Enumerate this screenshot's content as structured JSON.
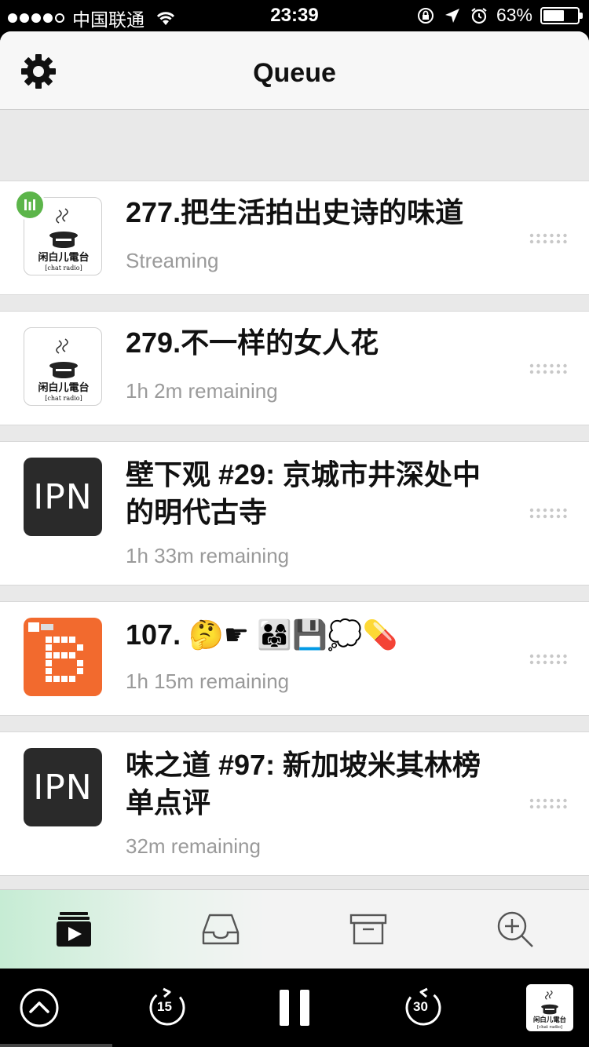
{
  "status_bar": {
    "carrier": "中国联通",
    "time": "23:39",
    "battery_percent": "63%",
    "battery_level": 0.63
  },
  "nav": {
    "title": "Queue",
    "settings_icon": "gear-icon"
  },
  "episodes": [
    {
      "title": "277.把生活拍出史诗的味道",
      "subtitle": "Streaming",
      "artwork": "chat-radio",
      "artwork_text": "闲白儿電台 [chat radio]",
      "now_playing": true
    },
    {
      "title": "279.不一样的女人花",
      "subtitle": "1h 2m remaining",
      "artwork": "chat-radio",
      "artwork_text": "闲白儿電台 [chat radio]"
    },
    {
      "title": "壁下观 #29: 京城市井深处中的明代古寺",
      "subtitle": "1h 33m remaining",
      "artwork": "ipn",
      "artwork_text": "IPN"
    },
    {
      "title": "107. 🤔☛ 👨‍👩‍👧💾💭💊",
      "subtitle": "1h 15m remaining",
      "artwork": "banjan",
      "artwork_text": "B"
    },
    {
      "title": "味之道 #97: 新加坡米其林榜单点评",
      "subtitle": "32m remaining",
      "artwork": "ipn",
      "artwork_text": "IPN"
    }
  ],
  "tabs": [
    {
      "name": "queue",
      "icon": "queue-play-icon",
      "active": true
    },
    {
      "name": "inbox",
      "icon": "inbox-icon"
    },
    {
      "name": "archive",
      "icon": "archive-icon"
    },
    {
      "name": "search",
      "icon": "search-add-icon"
    }
  ],
  "player": {
    "skip_back_seconds": "15",
    "skip_forward_seconds": "30",
    "progress": 0.19,
    "state": "playing"
  },
  "colors": {
    "now_playing_badge": "#5cb54a",
    "banjan_orange": "#f26a2e",
    "ipn_dark": "#2a2a2a"
  }
}
